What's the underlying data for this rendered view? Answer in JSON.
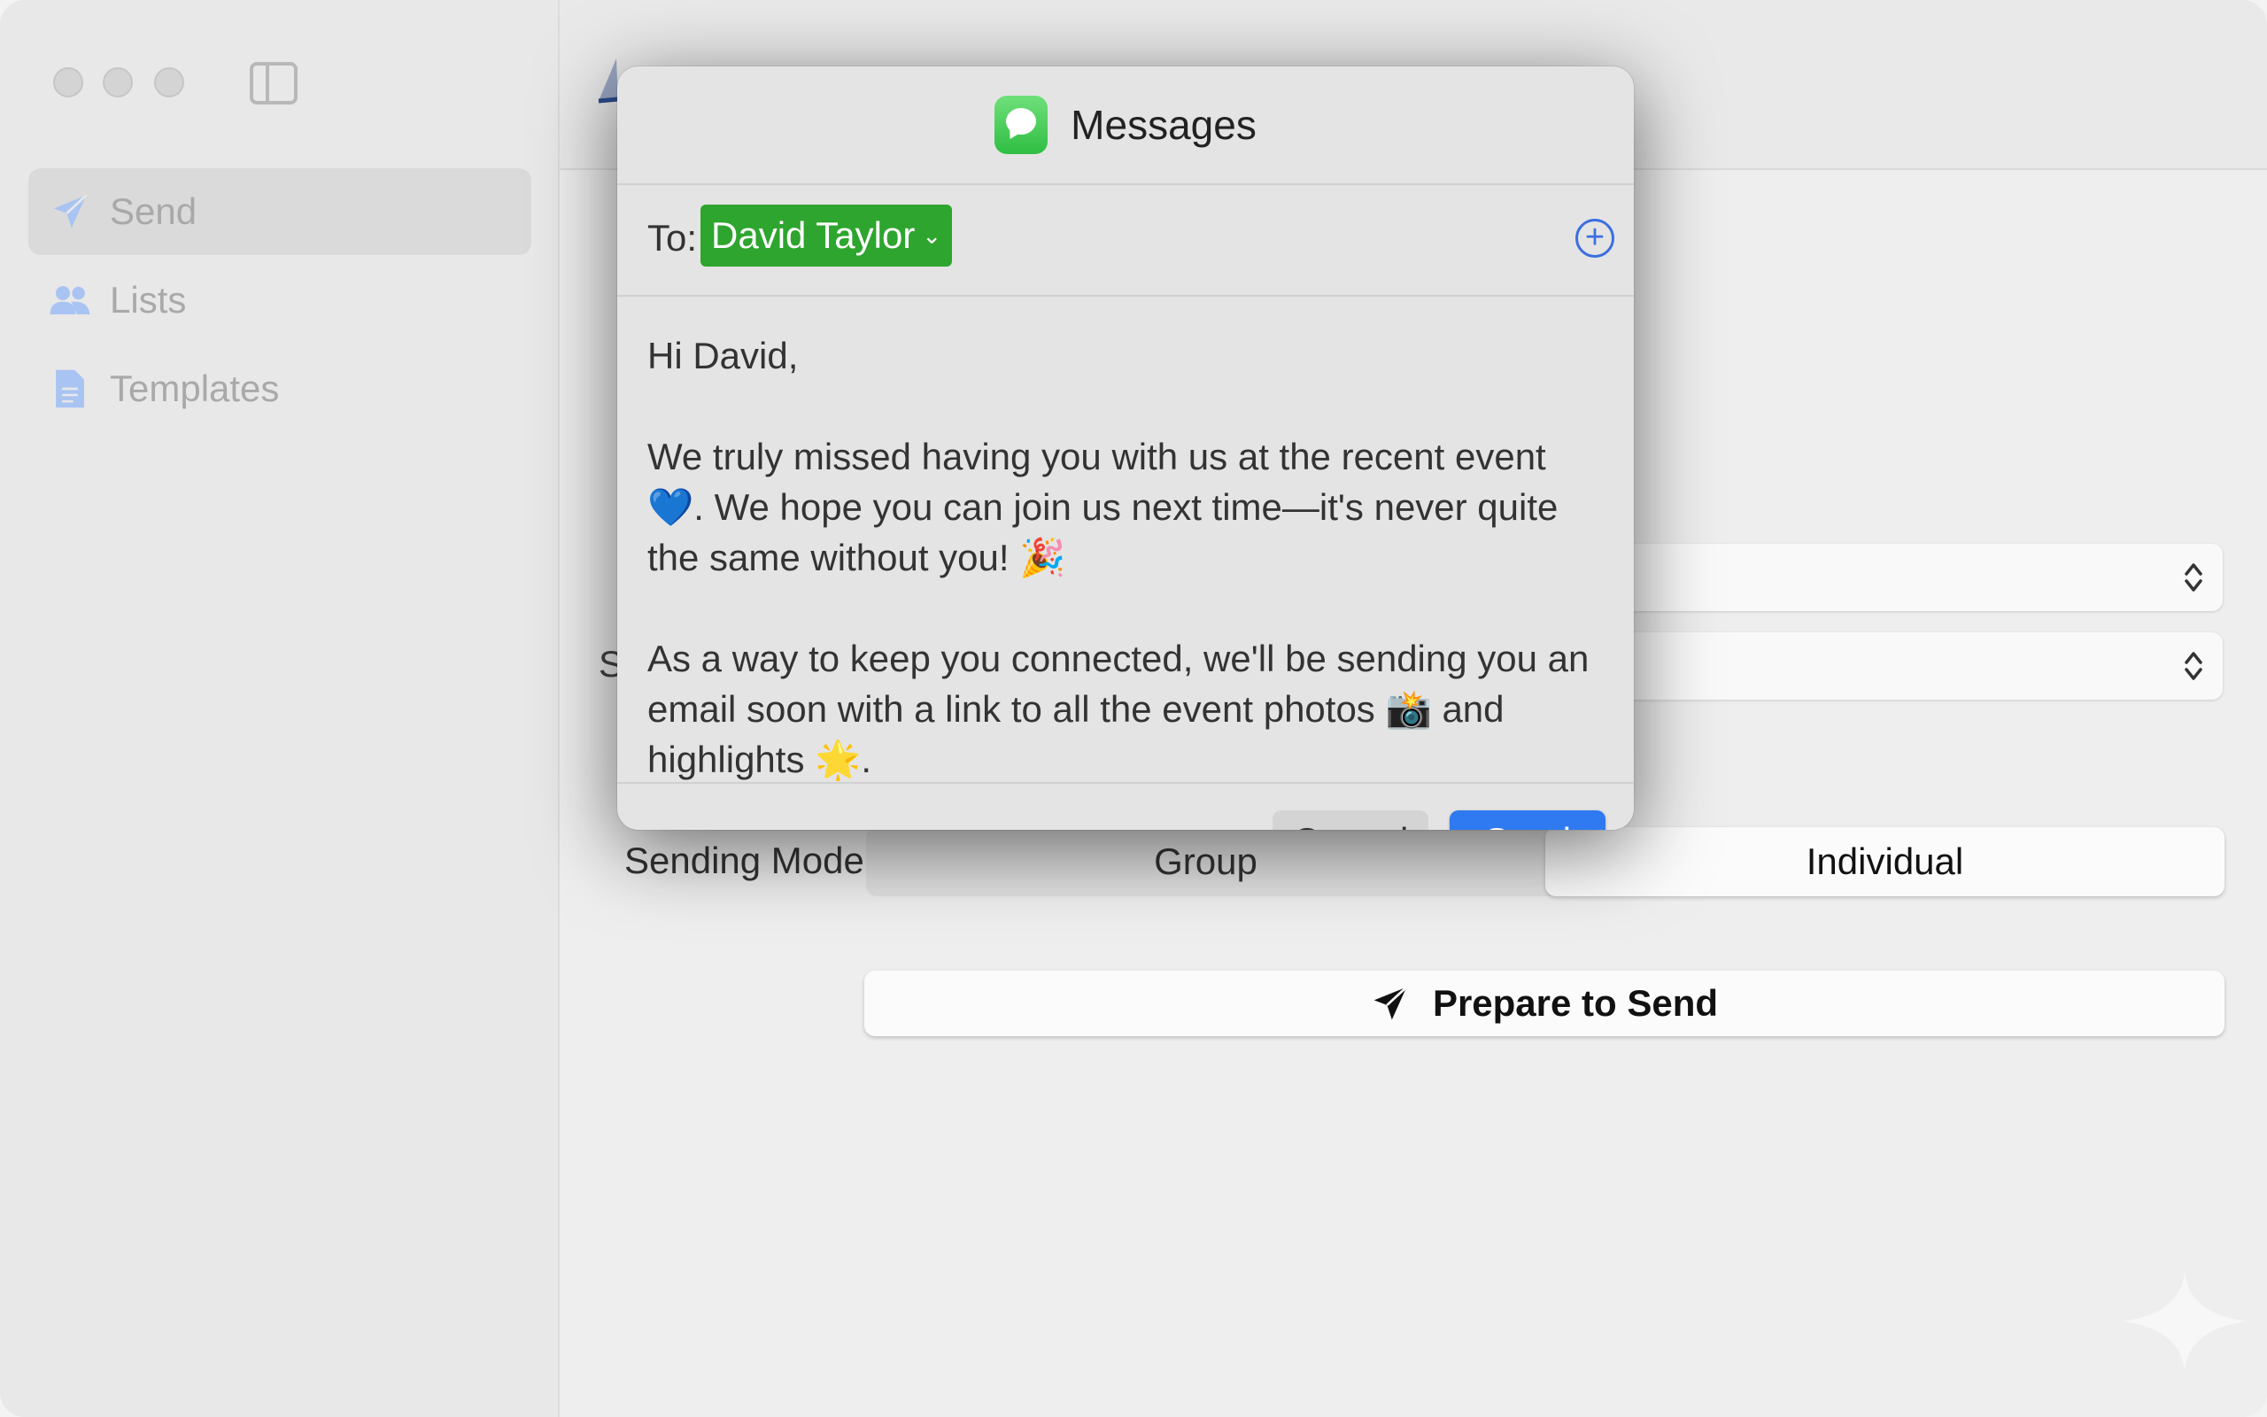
{
  "sidebar": {
    "items": [
      {
        "label": "Send",
        "icon": "paperplane-icon",
        "active": true
      },
      {
        "label": "Lists",
        "icon": "people-icon",
        "active": false
      },
      {
        "label": "Templates",
        "icon": "document-icon",
        "active": false
      }
    ]
  },
  "main": {
    "s_fragment": "S",
    "sending_mode": {
      "label": "Sending Mode",
      "options": [
        "Group",
        "Individual"
      ],
      "selected": "Individual"
    },
    "prepare_label": "Prepare to Send"
  },
  "modal": {
    "title": "Messages",
    "to_label": "To:",
    "recipient": "David Taylor",
    "message": {
      "greeting": "Hi David,",
      "para1": "We truly missed having you with us at the recent event 💙. We hope you can join us next time—it's never quite the same without you! 🎉",
      "para2": "As a way to keep you connected, we'll be sending you an email soon with a link to all the event photos 📸 and highlights 🌟."
    },
    "cancel_label": "Cancel",
    "send_label": "Send"
  },
  "colors": {
    "recipient_bg": "#2ea52e",
    "send_button": "#2f7af0",
    "sidebar_icon": "#a9c4f2"
  }
}
